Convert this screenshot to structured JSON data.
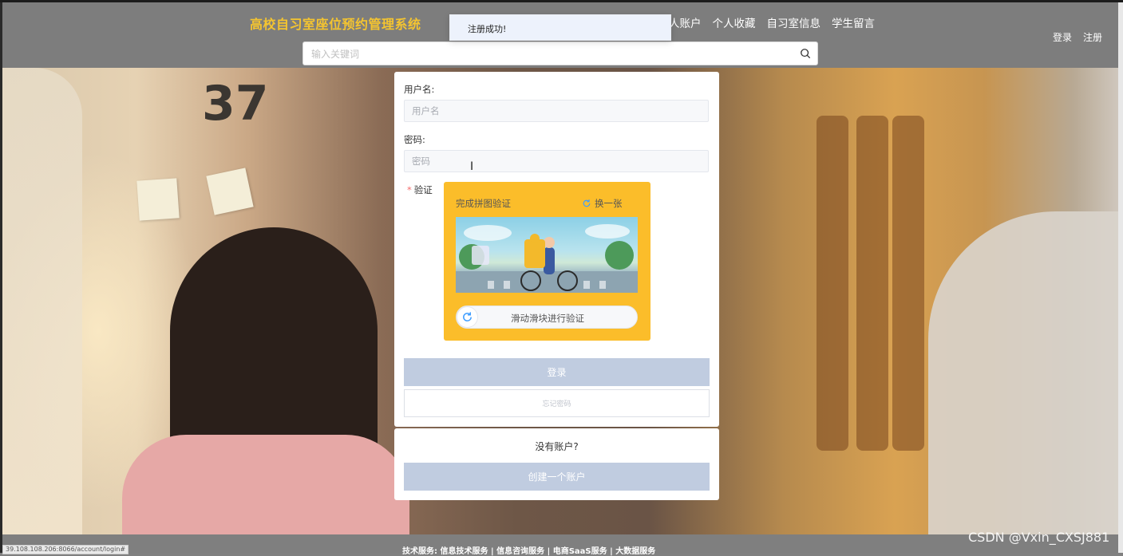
{
  "header": {
    "site_title": "高校自习室座位预约管理系统",
    "nav": [
      "人账户",
      "个人收藏",
      "自习室信息",
      "学生留言"
    ],
    "auth": {
      "login": "登录",
      "register": "注册"
    },
    "search_placeholder": "输入关键词"
  },
  "toast": {
    "message": "注册成功!"
  },
  "background": {
    "seat_number": "37"
  },
  "login_form": {
    "username_label": "用户名:",
    "username_placeholder": "用户名",
    "password_label": "密码:",
    "password_placeholder": "密码",
    "verify_label": "验证",
    "captcha": {
      "title": "完成拼图验证",
      "refresh_label": "换一张",
      "slider_text": "滑动滑块进行验证",
      "accent_color": "#fbbd2a"
    },
    "login_button": "登录",
    "forgot_button": "忘记密码"
  },
  "signup": {
    "prompt": "没有账户?",
    "create_button": "创建一个账户"
  },
  "footer": {
    "status_url": "39.108.108.206:8066/account/login#",
    "text": "技术服务: 信息技术服务 | 信息咨询服务 | 电商SaaS服务 | 大数据服务"
  },
  "watermark": "CSDN @Vxin_CXSJ881",
  "colors": {
    "header_bg": "#7d7d7d",
    "title_color": "#f4c430",
    "button_bg": "#c0cce0"
  }
}
